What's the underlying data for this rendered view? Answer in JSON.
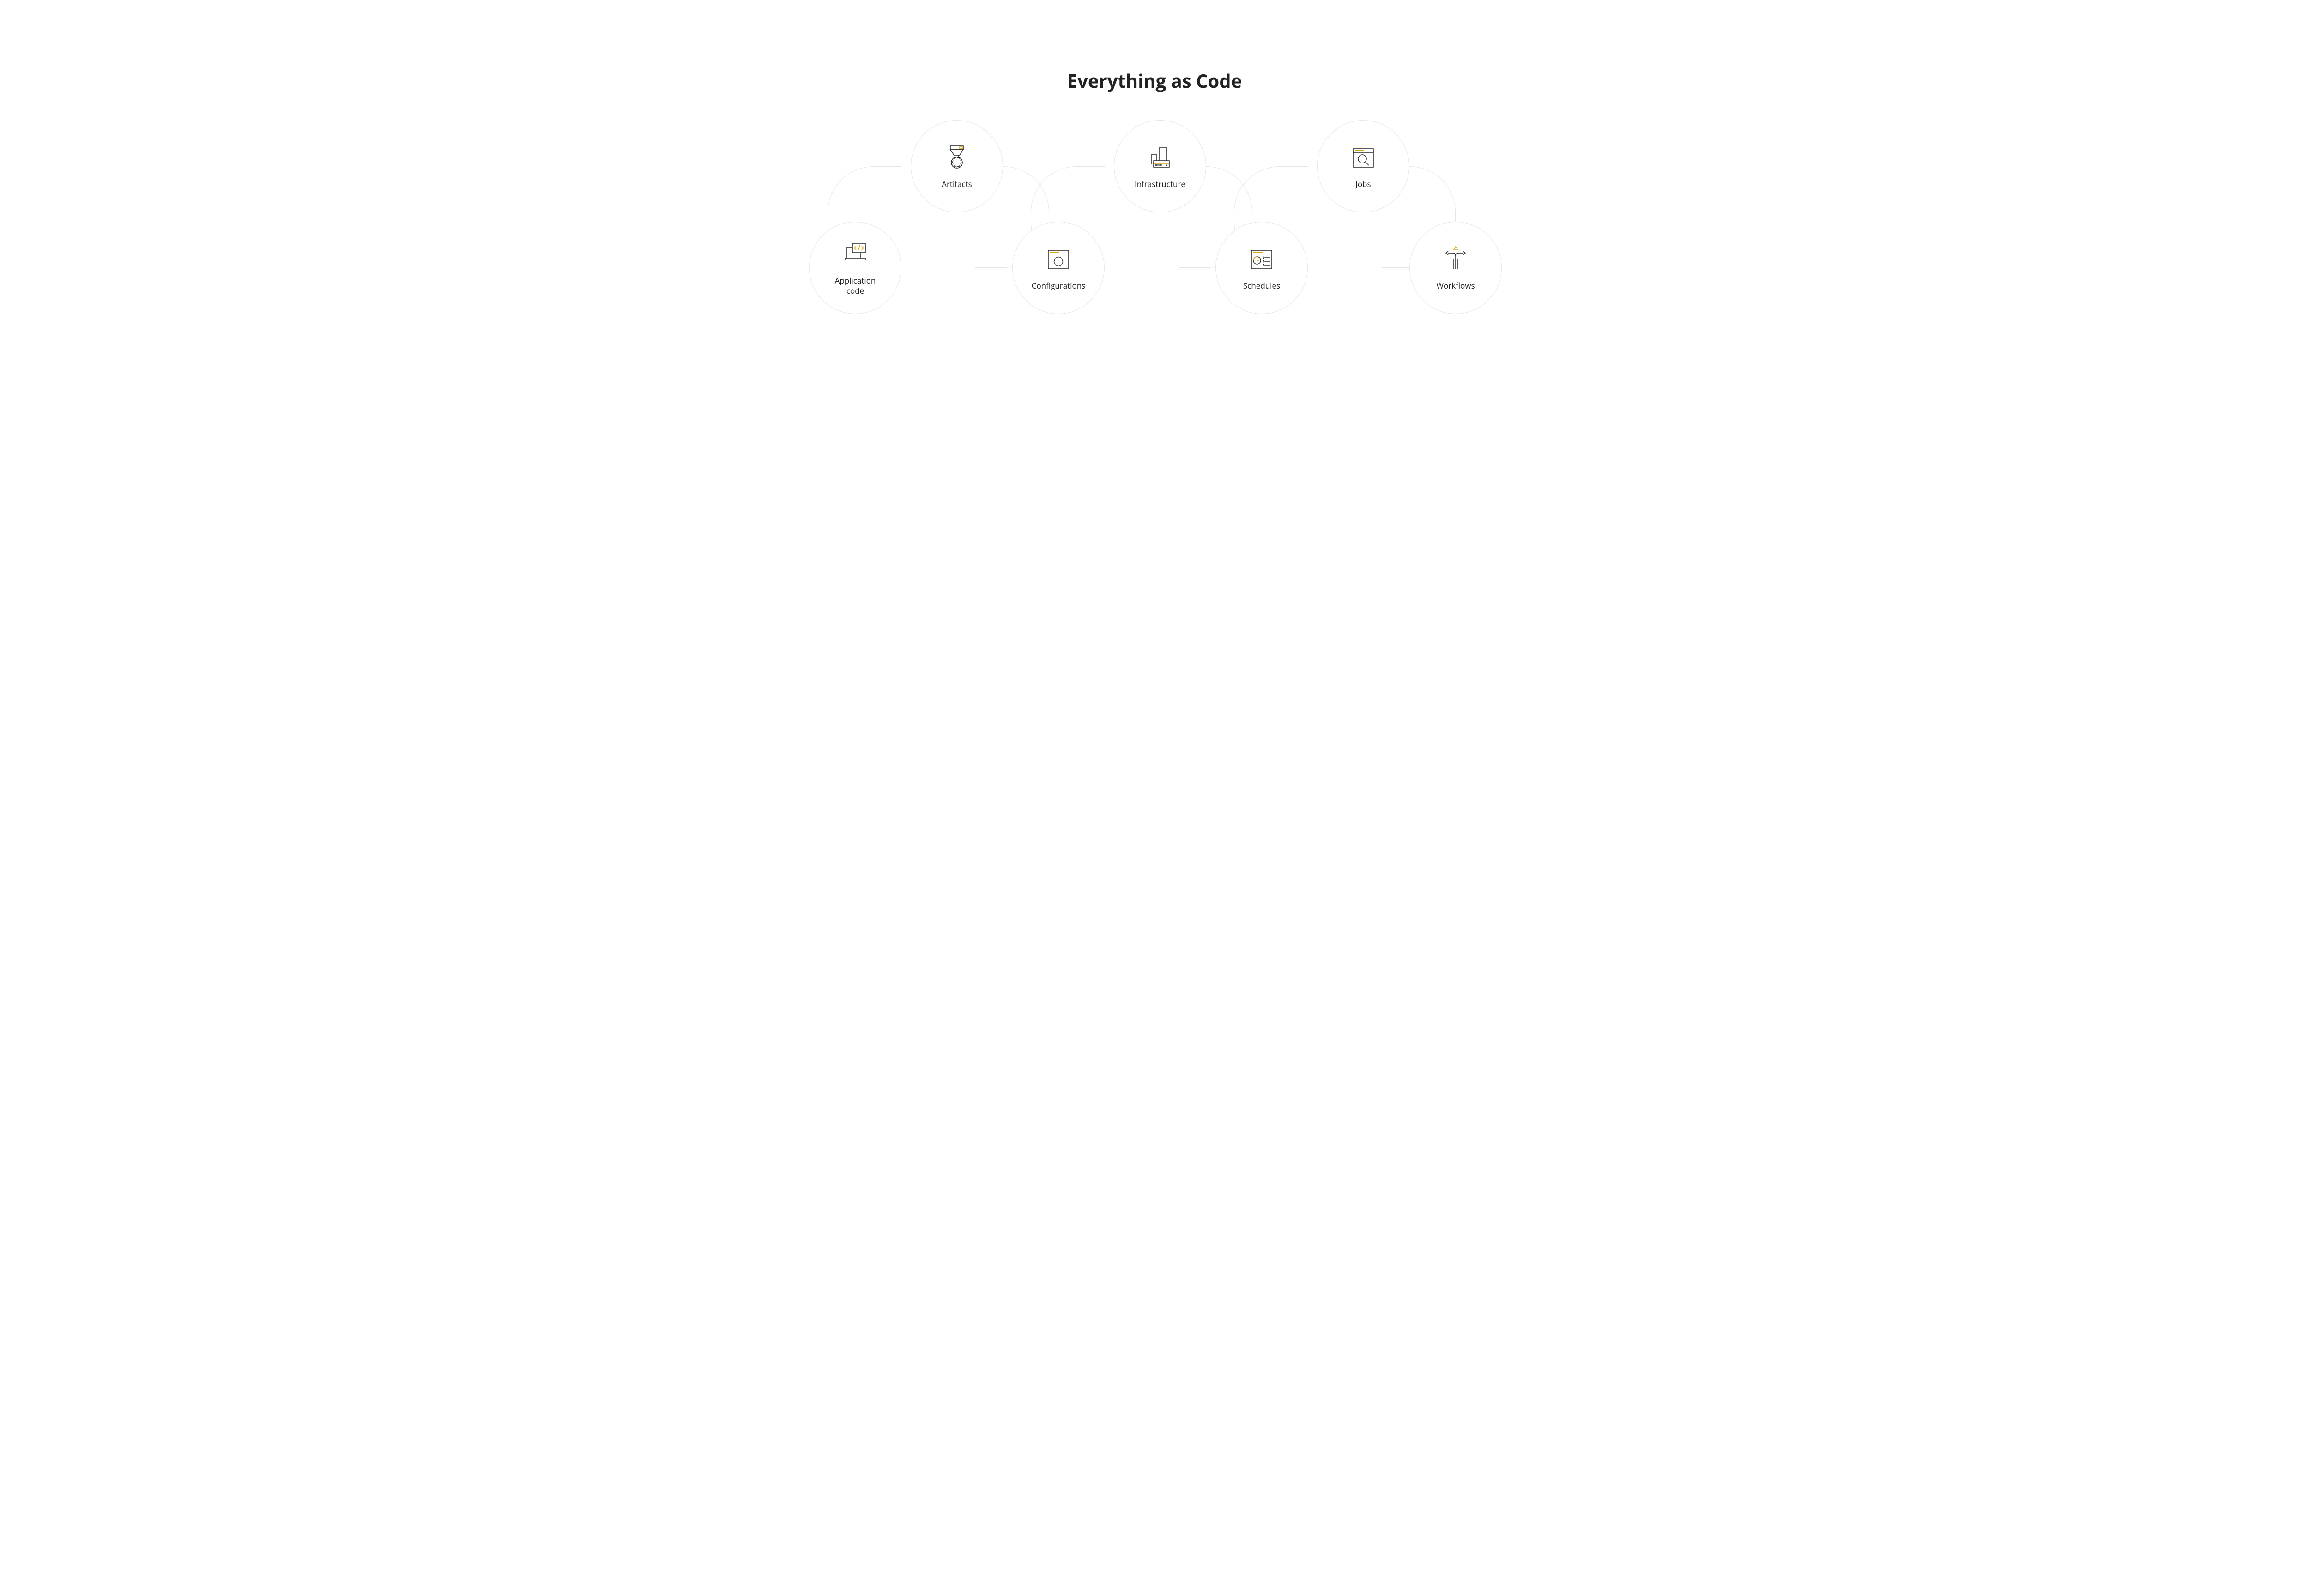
{
  "title": "Everything as Code",
  "nodes": [
    {
      "id": "application-code",
      "label": "Application\ncode"
    },
    {
      "id": "artifacts",
      "label": "Artifacts"
    },
    {
      "id": "configurations",
      "label": "Configurations"
    },
    {
      "id": "infrastructure",
      "label": "Infrastructure"
    },
    {
      "id": "schedules",
      "label": "Schedules"
    },
    {
      "id": "jobs",
      "label": "Jobs"
    },
    {
      "id": "workflows",
      "label": "Workflows"
    }
  ],
  "colors": {
    "accent": "#d9a400",
    "line": "#222",
    "circle": "#e5e5e5"
  }
}
